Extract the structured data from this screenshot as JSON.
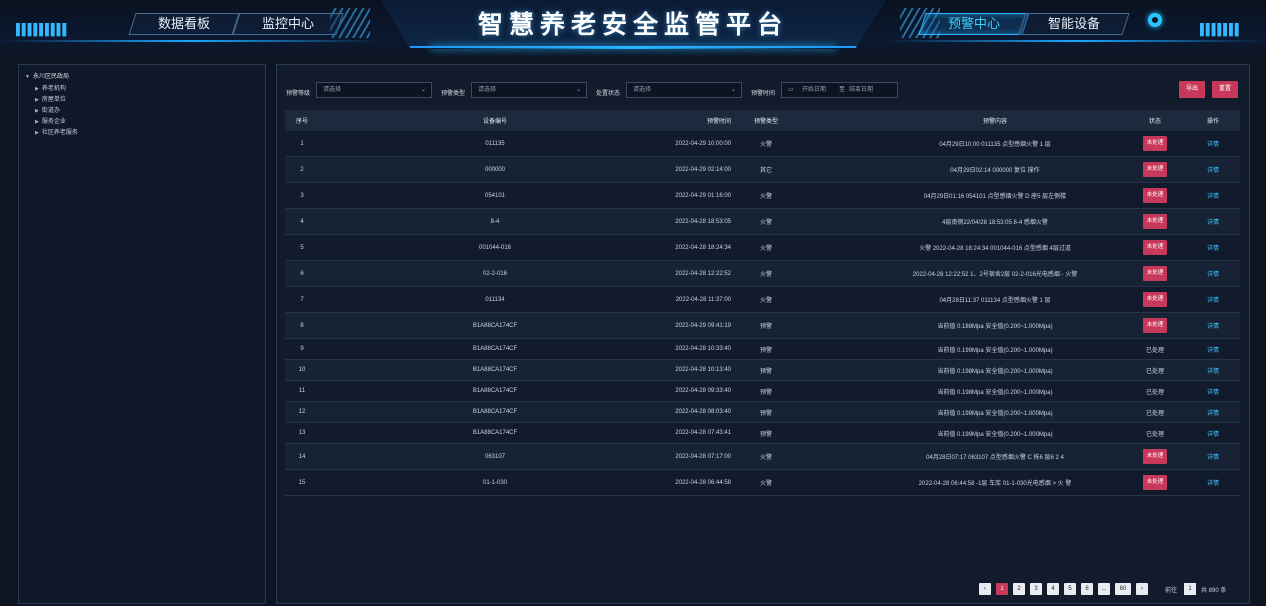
{
  "header": {
    "title": "智慧养老安全监管平台",
    "nav_left": [
      "数据看板",
      "监控中心"
    ],
    "nav_right": [
      "预警中心",
      "智能设备"
    ],
    "active_tab": "预警中心",
    "accent_color": "#2fb4ff"
  },
  "tree": {
    "root": "永川区民政局",
    "items": [
      "养老机构",
      "房屋单位",
      "街道办",
      "服务企业",
      "社区养老服务"
    ]
  },
  "filters": {
    "warning_level_label": "预警等级",
    "warning_level_placeholder": "请选择",
    "warning_type_label": "预警类型",
    "warning_type_placeholder": "请选择",
    "handle_status_label": "处置状态",
    "handle_status_placeholder": "请选择",
    "warning_time_label": "预警时间",
    "start_date_placeholder": "开始日期",
    "date_separator": "至",
    "end_date_placeholder": "结束日期",
    "export_button": "导出",
    "reset_button": "重置"
  },
  "table": {
    "columns": [
      "序号",
      "设备编号",
      "预警时间",
      "预警类型",
      "预警内容",
      "状态",
      "操作"
    ],
    "rows": [
      {
        "no": "1",
        "device": "011135",
        "time": "2022-04-29 10:00:00",
        "type": "火警",
        "content": "04月29日10:00 011135 点型感烟火警 1 层",
        "status": "未处理",
        "op": "详情"
      },
      {
        "no": "2",
        "device": "000000",
        "time": "2022-04-29 02:14:00",
        "type": "其它",
        "content": "04月29日02:14 000000 复位 操作",
        "status": "未处理",
        "op": "详情"
      },
      {
        "no": "3",
        "device": "054101",
        "time": "2022-04-29 01:16:00",
        "type": "火警",
        "content": "04月29日01:16 054101 点型感烟火警 D 座5 层左侧楼",
        "status": "未处理",
        "op": "详情"
      },
      {
        "no": "4",
        "device": "8-4",
        "time": "2022-04-28 18:53:05",
        "type": "火警",
        "content": "4层南侧22/04/28 18:53:05 8-4 感烟火警",
        "status": "未处理",
        "op": "详情"
      },
      {
        "no": "5",
        "device": "001044-016",
        "time": "2022-04-28 18:24:34",
        "type": "火警",
        "content": "火警 2022-04-28 18:24:34 001044-016 点型感烟 4层过道",
        "status": "未处理",
        "op": "详情"
      },
      {
        "no": "6",
        "device": "02-2-016",
        "time": "2022-04-28 12:22:52",
        "type": "火警",
        "content": "2022-04-28 12:22:52 1、2号宿舍2层 02-2-016光电感烟 - 火警",
        "status": "未处理",
        "op": "详情"
      },
      {
        "no": "7",
        "device": "011134",
        "time": "2022-04-28 11:37:00",
        "type": "火警",
        "content": "04月28日11:37 011134 点型感烟火警 1 层",
        "status": "未处理",
        "op": "详情"
      },
      {
        "no": "8",
        "device": "B1A88CA174CF",
        "time": "2022-04-29 09:41:19",
        "type": "预警",
        "content": "当前值 0.188Mpa 安全值(0.200~1.000Mpa)",
        "status": "未处理",
        "op": "详情"
      },
      {
        "no": "9",
        "device": "B1A88CA174CF",
        "time": "2022-04-28 10:33:40",
        "type": "预警",
        "content": "当前值 0.199Mpa 安全值(0.200~1.000Mpa)",
        "status": "已处理",
        "op": "详情"
      },
      {
        "no": "10",
        "device": "B1A88CA174CF",
        "time": "2022-04-28 10:13:40",
        "type": "预警",
        "content": "当前值 0.198Mpa 安全值(0.200~1.000Mpa)",
        "status": "已处理",
        "op": "详情"
      },
      {
        "no": "11",
        "device": "B1A88CA174CF",
        "time": "2022-04-28 09:33:40",
        "type": "预警",
        "content": "当前值 0.198Mpa 安全值(0.200~1.000Mpa)",
        "status": "已处理",
        "op": "详情"
      },
      {
        "no": "12",
        "device": "B1A88CA174CF",
        "time": "2022-04-28 08:03:40",
        "type": "预警",
        "content": "当前值 0.199Mpa 安全值(0.200~1.000Mpa)",
        "status": "已处理",
        "op": "详情"
      },
      {
        "no": "13",
        "device": "B1A88CA174CF",
        "time": "2022-04-28 07:43:41",
        "type": "预警",
        "content": "当前值 0.199Mpa 安全值(0.200~1.000Mpa)",
        "status": "已处理",
        "op": "详情"
      },
      {
        "no": "14",
        "device": "063107",
        "time": "2022-04-28 07:17:00",
        "type": "火警",
        "content": "04月28日07:17 063107 点型感烟火警 C 栋6 层6 2 4",
        "status": "未处理",
        "op": "详情"
      },
      {
        "no": "15",
        "device": "01-1-030",
        "time": "2022-04-28 06:44:58",
        "type": "火警",
        "content": "2022-04-28 06:44:58 -1层 车库 01-1-030光电感烟 > 火 警",
        "status": "未处理",
        "op": "详情"
      }
    ]
  },
  "pagination": {
    "prev": "‹",
    "pages": [
      "1",
      "2",
      "3",
      "4",
      "5",
      "6",
      "...",
      "60"
    ],
    "current": "1",
    "next": "›",
    "goto_label": "前往",
    "goto_value": "1",
    "total_text": "共 890 条"
  },
  "colors": {
    "background": "#0d1522",
    "badge_red": "#c8385a",
    "link_blue": "#3ec6ff"
  }
}
